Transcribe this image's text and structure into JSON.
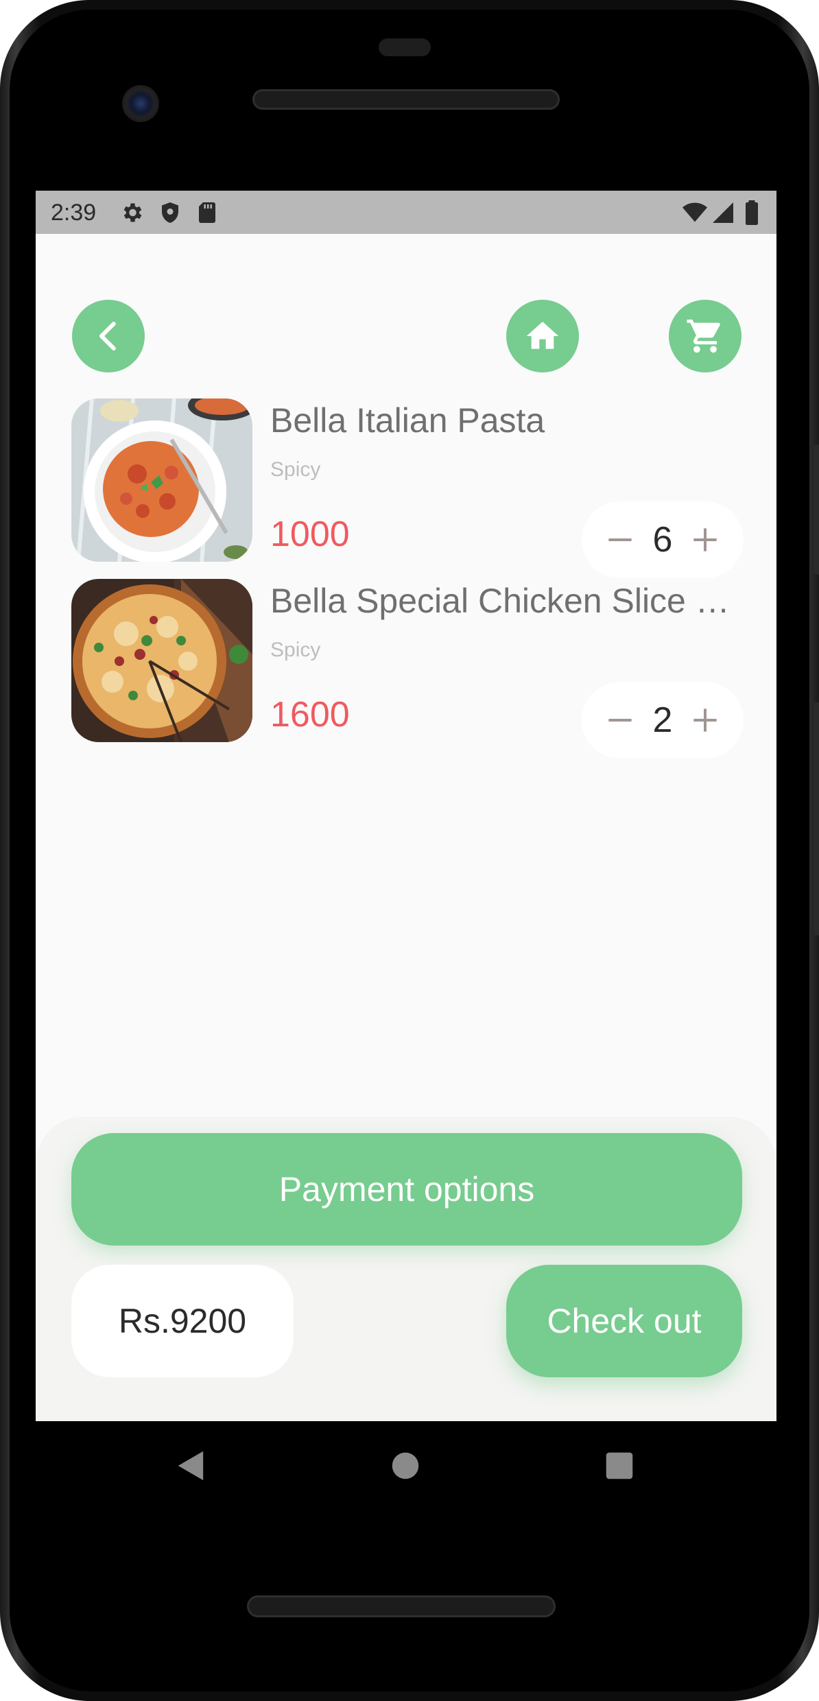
{
  "status_bar": {
    "time": "2:39",
    "left_icons": [
      "settings-icon",
      "shield-icon",
      "sd-card-icon"
    ],
    "right_icons": [
      "wifi-icon",
      "signal-icon",
      "battery-icon"
    ]
  },
  "header": {
    "back_icon": "chevron-left-icon",
    "home_icon": "home-icon",
    "cart_icon": "cart-icon",
    "accent_color": "#77cc8f"
  },
  "cart": {
    "items": [
      {
        "name": "Bella Italian Pasta",
        "tag": "Spicy",
        "price": "1000",
        "quantity": "6",
        "image": "pasta-image"
      },
      {
        "name": "Bella Special Chicken Slice Pizza",
        "tag": "Spicy",
        "price": "1600",
        "quantity": "2",
        "image": "pizza-image"
      }
    ]
  },
  "footer": {
    "payment_label": "Payment options",
    "total": "Rs.9200",
    "checkout_label": "Check out"
  },
  "colors": {
    "accent": "#77cc8f",
    "price": "#ef5a5f",
    "name": "#6f6f6f",
    "tag": "#bdbdbd"
  }
}
